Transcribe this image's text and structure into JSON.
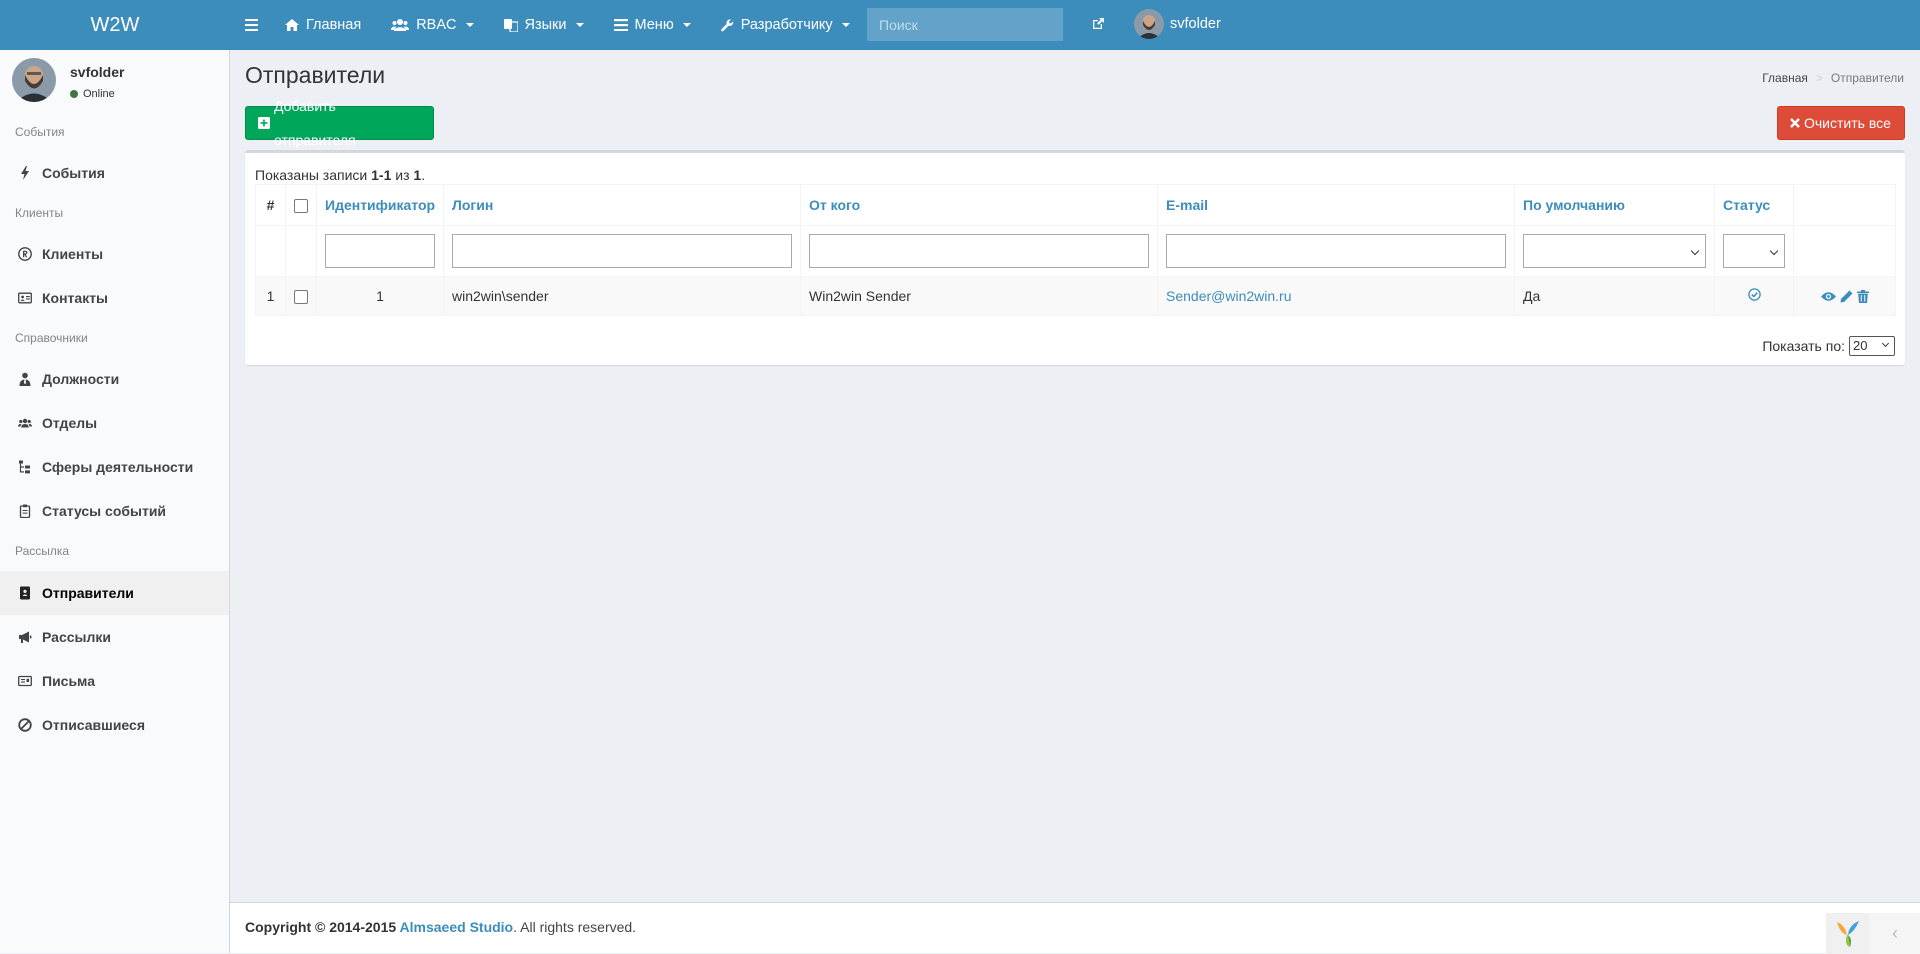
{
  "app": {
    "logo": "W2W"
  },
  "topnav": {
    "items": [
      {
        "label": "Главная",
        "icon": "home-icon",
        "dropdown": false
      },
      {
        "label": "RBAC",
        "icon": "users-icon",
        "dropdown": true
      },
      {
        "label": "Языки",
        "icon": "language-icon",
        "dropdown": true
      },
      {
        "label": "Меню",
        "icon": "bars-icon",
        "dropdown": true
      },
      {
        "label": "Разработчику",
        "icon": "wrench-icon",
        "dropdown": true
      }
    ],
    "search_placeholder": "Поиск",
    "username": "svfolder"
  },
  "sidebar": {
    "user": {
      "name": "svfolder",
      "status": "Online"
    },
    "sections": {
      "events": "События",
      "clients": "Клиенты",
      "references": "Справочники",
      "mailing": "Рассылка"
    },
    "items": {
      "events": "События",
      "clients": "Клиенты",
      "contacts": "Контакты",
      "positions": "Должности",
      "departments": "Отделы",
      "activities": "Сферы деятельности",
      "event_statuses": "Статусы событий",
      "senders": "Отправители",
      "mailings": "Рассылки",
      "letters": "Письма",
      "unsubscribed": "Отписавшиеся"
    }
  },
  "page": {
    "title": "Отправители",
    "breadcrumb": {
      "home": "Главная",
      "sep": ">",
      "current": "Отправители"
    },
    "add_button": "Добавить отправителя",
    "clear_button": "Очистить все"
  },
  "grid": {
    "summary": {
      "prefix": "Показаны записи ",
      "range": "1-1",
      "middle": " из ",
      "total": "1",
      "suffix": "."
    },
    "columns": {
      "num": "#",
      "id": "Идентификатор",
      "login": "Логин",
      "from": "От кого",
      "email": "E-mail",
      "default": "По умолчанию",
      "status": "Статус"
    },
    "rows": [
      {
        "num": "1",
        "id": "1",
        "login": "win2win\\sender",
        "from": "Win2win Sender",
        "email": "Sender@win2win.ru",
        "default": "Да",
        "status": "active"
      }
    ],
    "page_size_label": "Показать по:",
    "page_size": "20"
  },
  "footer": {
    "prefix": "Copyright © 2014-2015 ",
    "brand": "Almsaeed Studio",
    "suffix": ". All rights reserved."
  },
  "colors": {
    "header": "#3c8dbc",
    "success": "#00a65a",
    "danger": "#dd4b39",
    "link": "#3c8dbc"
  }
}
